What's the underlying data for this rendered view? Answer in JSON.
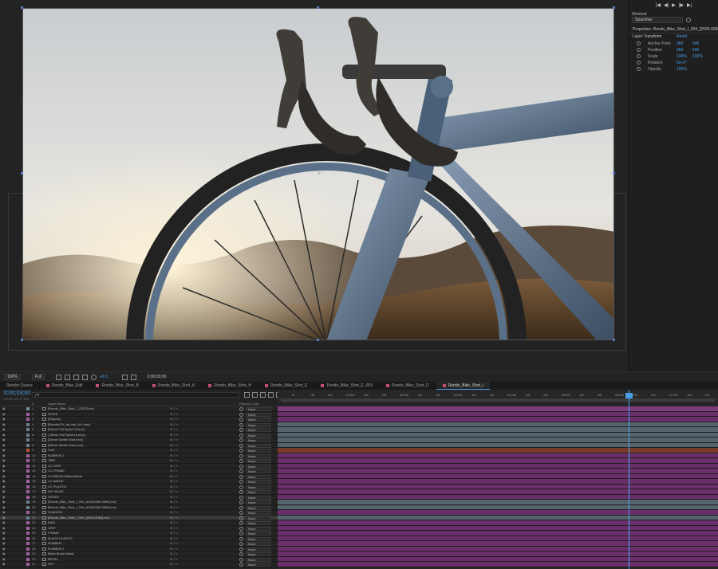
{
  "viewer": {
    "zoom": "100%",
    "resolution": "Full",
    "exposure": "+0.0",
    "timecode": "0;00;03;00"
  },
  "right_panel": {
    "transport": [
      "|◀",
      "◀|",
      "▶",
      "|▶",
      "▶|"
    ],
    "shortcut_label": "Shortcut",
    "shortcut_value": "Spacebar",
    "properties_title": "Properties: Rondo_Bike_Shot_I_004_[0000-0080].exr",
    "layer_transform": "Layer Transform",
    "reset": "Reset",
    "props": [
      {
        "name": "Anchor Point",
        "v1": "960",
        "v2": "540"
      },
      {
        "name": "Position",
        "v1": "960",
        "v2": "540"
      },
      {
        "name": "Scale",
        "v1": "100%",
        "v2": "100%"
      },
      {
        "name": "Rotation",
        "v1": "0x+0°",
        "v2": ""
      },
      {
        "name": "Opacity",
        "v1": "100%",
        "v2": ""
      }
    ]
  },
  "tabs": [
    {
      "label": "Render Queue",
      "color": ""
    },
    {
      "label": "Rondo_Bike_Edit",
      "color": "#c05070"
    },
    {
      "label": "Rondo_Bike_Shot_B",
      "color": "#c05070"
    },
    {
      "label": "Rondo_Bike_Shot_K",
      "color": "#c05070"
    },
    {
      "label": "Rondo_Bike_Shot_H",
      "color": "#c05070"
    },
    {
      "label": "Rondo_Bike_Shot_E",
      "color": "#c05070"
    },
    {
      "label": "Rondo_Bike_Shot_E_003",
      "color": "#c05070"
    },
    {
      "label": "Rondo_Bike_Shot_D",
      "color": "#c05070"
    },
    {
      "label": "Rondo_Bike_Shot_I",
      "color": "#c05070",
      "active": true
    }
  ],
  "timeline": {
    "timecode": "0;00;03;00",
    "timecode_sub": "00090 (29.97 fps)",
    "search_placeholder": "ρ▾",
    "col_num": "#",
    "col_layer_name": "Layer Name",
    "col_parent": "Parent & Link",
    "ruler_ticks": [
      "0f",
      "10f",
      "20f",
      "01:00f",
      "10f",
      "20f",
      "02:00f",
      "10f",
      "20f",
      "03:00f",
      "10f",
      "20f",
      "04:00f",
      "10f",
      "20f",
      "05:00f",
      "10f",
      "20f",
      "06:00f",
      "10f",
      "20f",
      "07:00f",
      "10f",
      "20f"
    ],
    "layers": [
      {
        "num": "1",
        "name": "[Rondo_Bike_Shot_I_23523.exr]",
        "color": "#7a8a9a",
        "track": "#7e3a7e"
      },
      {
        "num": "2",
        "name": "NOISE",
        "color": "#a060a0",
        "track": "#6a2f6a"
      },
      {
        "num": "3",
        "name": "[Shapes]",
        "color": "#a060a0",
        "track": "#6a2f6a"
      },
      {
        "num": "4",
        "name": "[RondoVFX_mLook_0c1.mov]",
        "color": "#6a7f8f",
        "track": "#55636c"
      },
      {
        "num": "5",
        "name": "[35mm Full Speed 5.mov]",
        "color": "#6a7f8f",
        "track": "#55636c"
      },
      {
        "num": "6",
        "name": "[ 35mm Full Speed 5.mov]",
        "color": "#6a7f8f",
        "track": "#55636c"
      },
      {
        "num": "7",
        "name": "[35mm Subtle Dust.mov]",
        "color": "#6a7f8f",
        "track": "#55636c"
      },
      {
        "num": "8",
        "name": "[35mm Subtle Dust.mov]",
        "color": "#6a7f8f",
        "track": "#55636c"
      },
      {
        "num": "9",
        "name": "SUN",
        "color": "#c05030",
        "track": "#7a3a2a"
      },
      {
        "num": "10",
        "name": "RUBBER 2",
        "color": "#a060a0",
        "track": "#6a2f6a"
      },
      {
        "num": "11",
        "name": "TIRE",
        "color": "#a060a0",
        "track": "#6a2f6a"
      },
      {
        "num": "12",
        "name": "CC GRIP",
        "color": "#a060a0",
        "track": "#6a2f6a"
      },
      {
        "num": "13",
        "name": "CC FRAME",
        "color": "#a060a0",
        "track": "#6a2f6a"
      },
      {
        "num": "14",
        "name": "CC BRUSH Black Metal",
        "color": "#a060a0",
        "track": "#6a2f6a"
      },
      {
        "num": "15",
        "name": "CC IMAGE",
        "color": "#a060a0",
        "track": "#6a2f6a"
      },
      {
        "num": "16",
        "name": "CC PLASTIC",
        "color": "#a060a0",
        "track": "#6a2f6a"
      },
      {
        "num": "17",
        "name": "SKY BLUE",
        "color": "#a060a0",
        "track": "#6a2f6a"
      },
      {
        "num": "18",
        "name": "GRASS",
        "color": "#a060a0",
        "track": "#6a2f6a"
      },
      {
        "num": "19",
        "name": "[Rondo_Bike_Shot_I_004_AOV[0000-0080].exr]",
        "color": "#6a7f8f",
        "track": "#55636c"
      },
      {
        "num": "20",
        "name": "[Rondo_Bike_Shot_I_004_AOV[0000-0080].exr]",
        "color": "#6a7f8f",
        "track": "#55636c"
      },
      {
        "num": "21",
        "name": "SHADOW",
        "color": "#a060a0",
        "track": "#6a2f6a"
      },
      {
        "num": "22",
        "name": "[Rondo_Bike_Shot_I_004_[0000-0080].exr]",
        "color": "#6a7f8f",
        "track": "#55636c",
        "selected": true
      },
      {
        "num": "23",
        "name": "BIKE",
        "color": "#a060a0",
        "track": "#6a2f6a"
      },
      {
        "num": "24",
        "name": "GRIP",
        "color": "#a060a0",
        "track": "#6a2f6a"
      },
      {
        "num": "25",
        "name": "FRAME",
        "color": "#a060a0",
        "track": "#6a2f6a"
      },
      {
        "num": "26",
        "name": "BLACK PLASTIC",
        "color": "#a060a0",
        "track": "#6a2f6a"
      },
      {
        "num": "27",
        "name": "RUBBER",
        "color": "#a060a0",
        "track": "#6a2f6a"
      },
      {
        "num": "28",
        "name": "RUBBER 2",
        "color": "#a060a0",
        "track": "#6a2f6a"
      },
      {
        "num": "29",
        "name": "Black Brush Metal",
        "color": "#a060a0",
        "track": "#6a2f6a"
      },
      {
        "num": "30",
        "name": "METAL",
        "color": "#a060a0",
        "track": "#6a2f6a"
      },
      {
        "num": "31",
        "name": "SKY",
        "color": "#a060a0",
        "track": "#6a2f6a"
      }
    ],
    "parent_value": "None",
    "eye_glyph": "◉",
    "switch_glyphs": "⊕ ⁄ ∕ ◐"
  }
}
